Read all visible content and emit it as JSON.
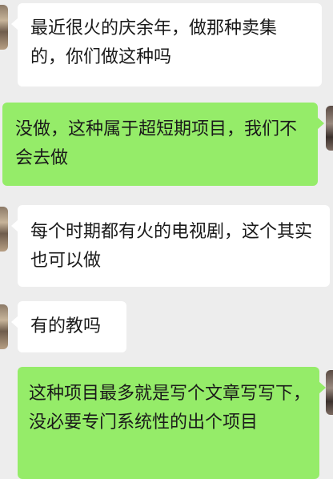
{
  "messages": [
    {
      "direction": "incoming",
      "text": "最近很火的庆余年，做那种卖集的，你们做这种吗"
    },
    {
      "direction": "outgoing",
      "text": "没做，这种属于超短期项目，我们不会去做"
    },
    {
      "direction": "incoming",
      "text": "每个时期都有火的电视剧，这个其实也可以做"
    },
    {
      "direction": "incoming",
      "text": "有的教吗"
    },
    {
      "direction": "outgoing",
      "text": "这种项目最多就是写个文章写写下，没必要专门系统性的出个项目"
    }
  ],
  "colors": {
    "background": "#ededed",
    "incoming_bubble": "#ffffff",
    "outgoing_bubble": "#95ec69"
  }
}
